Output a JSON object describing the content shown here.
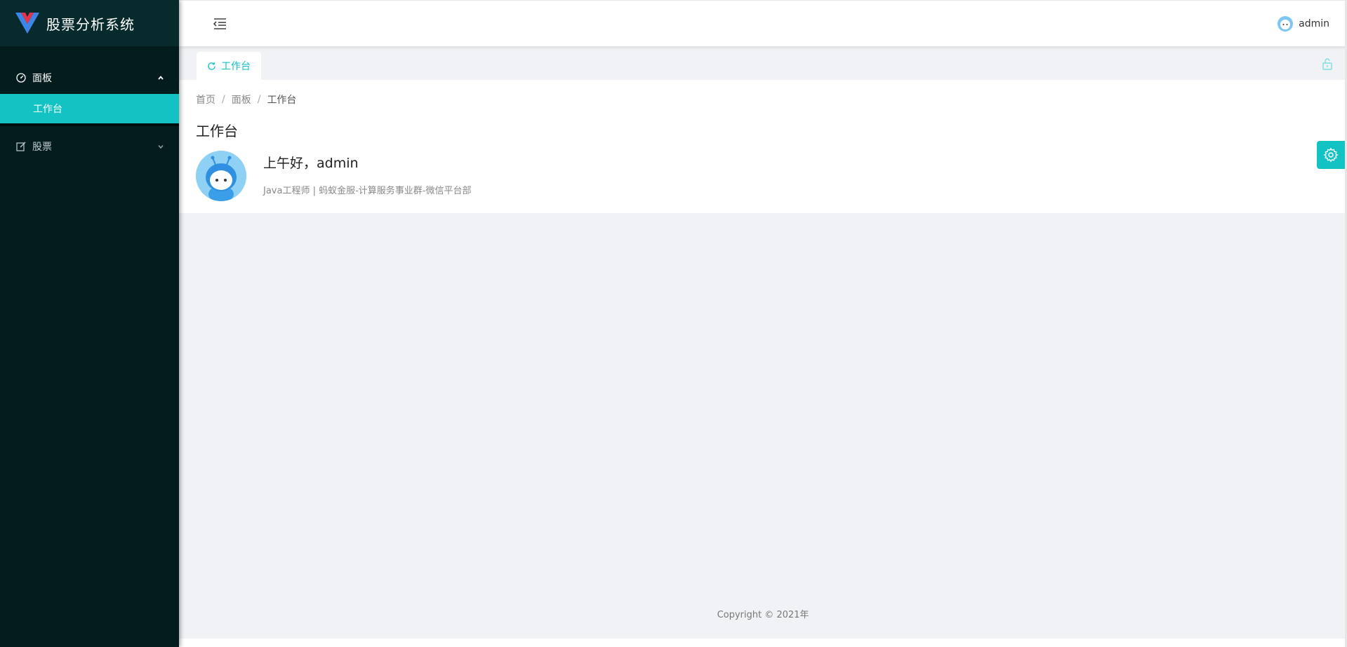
{
  "app": {
    "title": "股票分析系统",
    "logo_icon": "vue-logo-icon"
  },
  "sidebar": {
    "groups": [
      {
        "label": "面板",
        "icon": "dashboard-icon",
        "expanded": true,
        "items": [
          {
            "label": "工作台",
            "active": true
          }
        ]
      },
      {
        "label": "股票",
        "icon": "edit-icon",
        "expanded": false,
        "items": []
      }
    ]
  },
  "header": {
    "username": "admin"
  },
  "tabs": [
    {
      "label": "工作台",
      "icon": "reload-icon",
      "active": true
    }
  ],
  "breadcrumb": [
    "首页",
    "面板",
    "工作台"
  ],
  "page": {
    "title": "工作台",
    "greeting": "上午好，admin",
    "description": "Java工程师 | 蚂蚁金服-计算服务事业群-微信平台部"
  },
  "footer": {
    "copyright": "Copyright © 2021年"
  },
  "colors": {
    "accent": "#13c2c2",
    "sidebar_bg": "#031d1f",
    "content_bg": "#f0f2f5"
  }
}
